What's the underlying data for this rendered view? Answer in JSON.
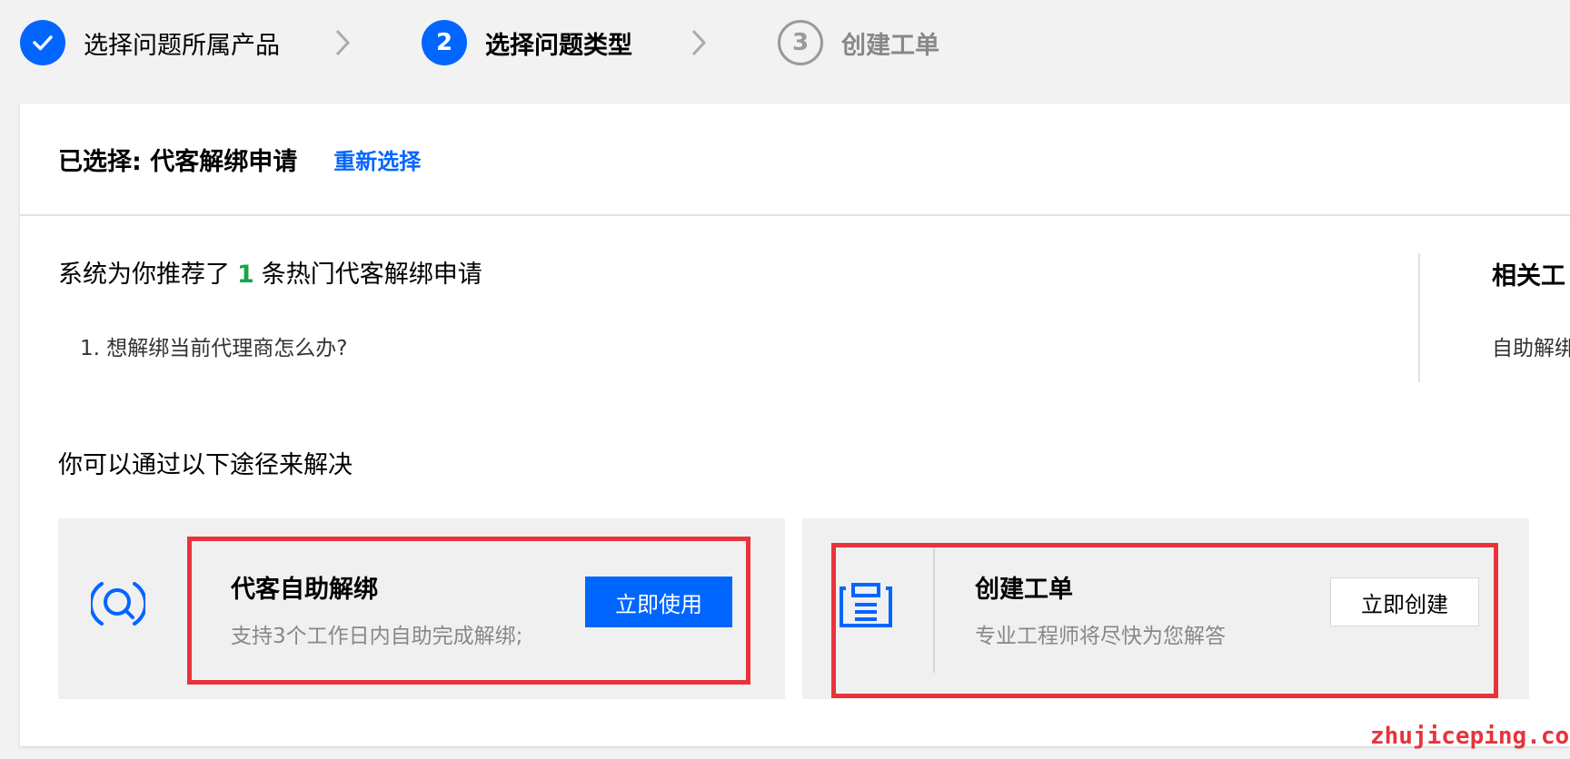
{
  "steps": [
    {
      "number": "",
      "label": "选择问题所属产品",
      "state": "done"
    },
    {
      "number": "2",
      "label": "选择问题类型",
      "state": "active"
    },
    {
      "number": "3",
      "label": "创建工单",
      "state": "pending"
    }
  ],
  "header": {
    "selected_label": "已选择: 代客解绑申请",
    "reselect_label": "重新选择"
  },
  "recommend": {
    "prefix": "系统为你推荐了",
    "count": "1",
    "suffix": "条热门代客解绑申请",
    "items": [
      "1. 想解绑当前代理商怎么办?"
    ]
  },
  "related": {
    "title": "相关工",
    "item": "自助解绑"
  },
  "ways": {
    "title": "你可以通过以下途径来解决",
    "self_service": {
      "icon": "search-icon",
      "title": "代客自助解绑",
      "desc": "支持3个工作日内自助完成解绑;",
      "button": "立即使用"
    },
    "ticket": {
      "icon": "ticket-icon",
      "title": "创建工单",
      "desc": "专业工程师将尽快为您解答",
      "button": "立即创建"
    }
  },
  "colors": {
    "accent": "#0066ff",
    "success": "#1aa34a",
    "highlight": "#e8333b"
  },
  "watermark": "zhujiceping.com"
}
